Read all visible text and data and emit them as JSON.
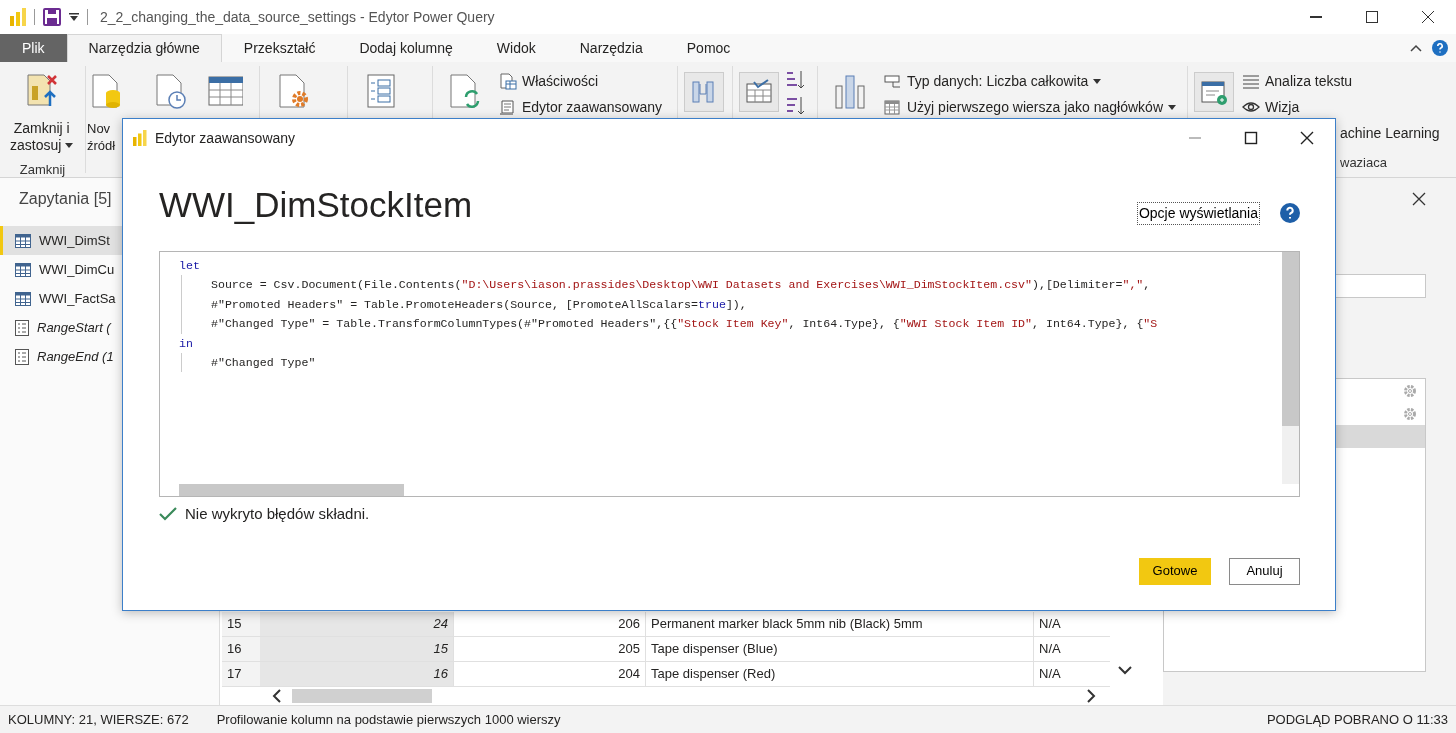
{
  "window": {
    "title": "2_2_changing_the_data_source_settings - Edytor Power Query"
  },
  "ribbon_tabs": [
    {
      "label": "Plik",
      "kind": "file",
      "selected": false
    },
    {
      "label": "Narzędzia główne",
      "kind": "tab",
      "selected": true
    },
    {
      "label": "Przekształć",
      "kind": "tab",
      "selected": false
    },
    {
      "label": "Dodaj kolumnę",
      "kind": "tab",
      "selected": false
    },
    {
      "label": "Widok",
      "kind": "tab",
      "selected": false
    },
    {
      "label": "Narzędzia",
      "kind": "tab",
      "selected": false
    },
    {
      "label": "Pomoc",
      "kind": "tab",
      "selected": false
    }
  ],
  "ribbon_groups": [
    {
      "label": "Zamknij",
      "items": [
        {
          "kind": "large",
          "lines": [
            "Zamknij i",
            "zastosuj"
          ],
          "dropdown": true
        }
      ]
    },
    {
      "items": [
        {
          "kind": "large",
          "lines": [
            "Nov",
            "źródł"
          ]
        },
        {
          "kind": "large"
        },
        {
          "kind": "large"
        }
      ]
    },
    {
      "items": [
        {
          "kind": "large"
        }
      ]
    },
    {
      "items": [
        {
          "kind": "large"
        }
      ]
    },
    {
      "items": [
        {
          "kind": "large"
        },
        {
          "kind": "stack",
          "entries": [
            {
              "label": "Właściwości",
              "kind": "item"
            },
            {
              "label": "Edytor zaawansowany",
              "kind": "item"
            }
          ]
        }
      ]
    },
    {
      "items": [
        {
          "kind": "boxed"
        }
      ]
    },
    {
      "items": [
        {
          "kind": "boxed"
        },
        {
          "kind": "sort"
        }
      ]
    },
    {
      "items": [
        {
          "kind": "large"
        },
        {
          "kind": "stack",
          "entries": [
            {
              "label": "Typ danych: Liczba całkowita",
              "kind": "item",
              "dropdown": true
            },
            {
              "label": "Użyj pierwszego wiersza jako nagłówków",
              "kind": "item",
              "dropdown": true
            }
          ]
        }
      ]
    },
    {
      "label": "waziaca",
      "items": [
        {
          "kind": "boxed"
        },
        {
          "kind": "stack",
          "entries": [
            {
              "label": "Analiza tekstu",
              "kind": "item"
            },
            {
              "label": "Wizja",
              "kind": "item"
            },
            {
              "label": "achine Learning",
              "kind": "partial"
            }
          ]
        }
      ]
    }
  ],
  "queries": {
    "title": "Zapytania [5]",
    "items": [
      {
        "label": "WWI_DimSt",
        "kind": "table",
        "selected": true
      },
      {
        "label": "WWI_DimCu",
        "kind": "table",
        "selected": false
      },
      {
        "label": "WWI_FactSa",
        "kind": "table",
        "selected": false
      },
      {
        "label": "RangeStart (",
        "kind": "parameter",
        "selected": false
      },
      {
        "label": "RangeEnd (1",
        "kind": "parameter",
        "selected": false
      }
    ]
  },
  "grid": {
    "rows": [
      {
        "number": "15",
        "cells": [
          "24",
          "206",
          "Permanent marker black 5mm nib (Black) 5mm",
          "N/A"
        ]
      },
      {
        "number": "16",
        "cells": [
          "15",
          "205",
          "Tape dispenser (Blue)",
          "N/A"
        ]
      },
      {
        "number": "17",
        "cells": [
          "16",
          "204",
          "Tape dispenser (Red)",
          "N/A"
        ]
      }
    ]
  },
  "applied_steps": [
    {
      "kind": "settings",
      "selected": false
    },
    {
      "kind": "settings",
      "selected": false
    },
    {
      "kind": "plain",
      "selected": true
    }
  ],
  "status_bar": {
    "left": "KOLUMNY: 21, WIERSZE: 672",
    "middle": "Profilowanie kolumn na podstawie pierwszych 1000 wierszy",
    "right": "PODGLĄD POBRANO O 11:33"
  },
  "dialog": {
    "title": "Edytor zaawansowany",
    "query_name": "WWI_DimStockItem",
    "display_options": "Opcje wyświetlania",
    "code": [
      {
        "tokens": [
          {
            "kind": "keyword",
            "text": "let"
          }
        ],
        "children": [
          {
            "tokens": [
              {
                "kind": "plain",
                "text": "Source = Csv.Document(File.Contents("
              },
              {
                "kind": "string",
                "text": "\"D:\\Users\\iason.prassides\\Desktop\\WWI Datasets and Exercises\\WWI_DimStockItem.csv\""
              },
              {
                "kind": "plain",
                "text": "),[Delimiter="
              },
              {
                "kind": "string",
                "text": "\",\""
              },
              {
                "kind": "plain",
                "text": ","
              }
            ]
          },
          {
            "tokens": [
              {
                "kind": "plain",
                "text": "#\"Promoted Headers\" = Table.PromoteHeaders(Source, [PromoteAllScalars="
              },
              {
                "kind": "keyword",
                "text": "true"
              },
              {
                "kind": "plain",
                "text": "]),"
              }
            ]
          },
          {
            "tokens": [
              {
                "kind": "plain",
                "text": "#\"Changed Type\" = Table.TransformColumnTypes(#\"Promoted Headers\",{{"
              },
              {
                "kind": "string",
                "text": "\"Stock Item Key\""
              },
              {
                "kind": "plain",
                "text": ", Int64.Type}, {"
              },
              {
                "kind": "string",
                "text": "\"WWI Stock Item ID\""
              },
              {
                "kind": "plain",
                "text": ", Int64.Type}, {"
              },
              {
                "kind": "string",
                "text": "\"S"
              }
            ]
          }
        ]
      },
      {
        "tokens": [
          {
            "kind": "keyword",
            "text": "in"
          }
        ],
        "children": [
          {
            "tokens": [
              {
                "kind": "plain",
                "text": "#\"Changed Type\""
              }
            ]
          }
        ]
      }
    ],
    "status": "Nie wykryto błędów składni.",
    "buttons": [
      {
        "label": "Gotowe",
        "kind": "primary"
      },
      {
        "label": "Anuluj",
        "kind": "secondary"
      }
    ]
  }
}
